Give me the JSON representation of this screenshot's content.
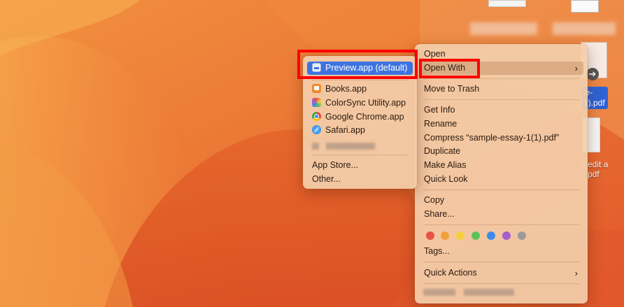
{
  "desktop": {
    "files": [
      {
        "label_lines": [
          "le-",
          "1).pdf"
        ]
      },
      {
        "label_lines": [
          "o edit a",
          "pdf"
        ]
      }
    ]
  },
  "context_menu": {
    "open": "Open",
    "open_with": "Open With",
    "move_to_trash": "Move to Trash",
    "get_info": "Get Info",
    "rename": "Rename",
    "compress": "Compress “sample-essay-1(1).pdf”",
    "duplicate": "Duplicate",
    "make_alias": "Make Alias",
    "quick_look": "Quick Look",
    "copy": "Copy",
    "share": "Share...",
    "tags": "Tags...",
    "quick_actions": "Quick Actions",
    "tag_colors": [
      "#e8524a",
      "#f0a03a",
      "#f4d03f",
      "#5bc25e",
      "#3d8be8",
      "#a55fcf",
      "#9a9a9a"
    ]
  },
  "open_with_menu": {
    "apps": [
      {
        "label": "Preview.app (default)",
        "icon": "preview-icon",
        "selected": true
      },
      {
        "label": "Books.app",
        "icon": "books-icon"
      },
      {
        "label": "ColorSync Utility.app",
        "icon": "colorsync-icon"
      },
      {
        "label": "Google Chrome.app",
        "icon": "chrome-icon"
      },
      {
        "label": "Safari.app",
        "icon": "safari-icon"
      }
    ],
    "app_store": "App Store...",
    "other": "Other..."
  },
  "colors": {
    "highlight_border": "#ff0000",
    "selection": "#3d73e0"
  }
}
